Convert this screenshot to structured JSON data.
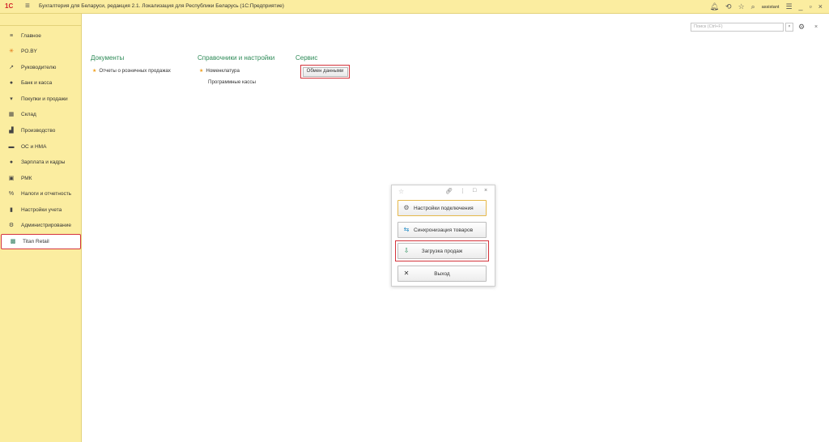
{
  "titlebar": {
    "logo": "1С",
    "title": "Бухгалтерия для Беларуси, редакция 2.1. Локализация для Республики Беларусь   (1С:Предприятие)",
    "user": "assistant"
  },
  "sidebar": {
    "items": [
      {
        "label": "Главное",
        "icon": "≡"
      },
      {
        "label": "PO.BY",
        "icon": "✳"
      },
      {
        "label": "Руководителю",
        "icon": "↗"
      },
      {
        "label": "Банк и касса",
        "icon": "●"
      },
      {
        "label": "Покупки и продажи",
        "icon": "▾"
      },
      {
        "label": "Склад",
        "icon": "▦"
      },
      {
        "label": "Производство",
        "icon": "▟"
      },
      {
        "label": "ОС и НМА",
        "icon": "▬"
      },
      {
        "label": "Зарплата и кадры",
        "icon": "●"
      },
      {
        "label": "РМК",
        "icon": "▣"
      },
      {
        "label": "Налоги и отчетность",
        "icon": "%"
      },
      {
        "label": "Настройки учета",
        "icon": "▮"
      },
      {
        "label": "Администрирование",
        "icon": "⚙"
      },
      {
        "label": "Titan Retail",
        "icon": "▩"
      }
    ]
  },
  "search": {
    "placeholder": "Поиск (Ctrl+F)"
  },
  "sections": {
    "documents": {
      "title": "Документы",
      "links": [
        "Отчеты о розничных продажах"
      ]
    },
    "references": {
      "title": "Справочники и настройки",
      "links": [
        "Номенклатура",
        "Программные кассы"
      ]
    },
    "service": {
      "title": "Сервис",
      "button": "Обмен данными"
    }
  },
  "dialog": {
    "buttons": {
      "connection": "Настройки подключения",
      "sync": "Синхронизация товаров",
      "sales": "Загрузка продаж",
      "exit": "Выход"
    }
  }
}
